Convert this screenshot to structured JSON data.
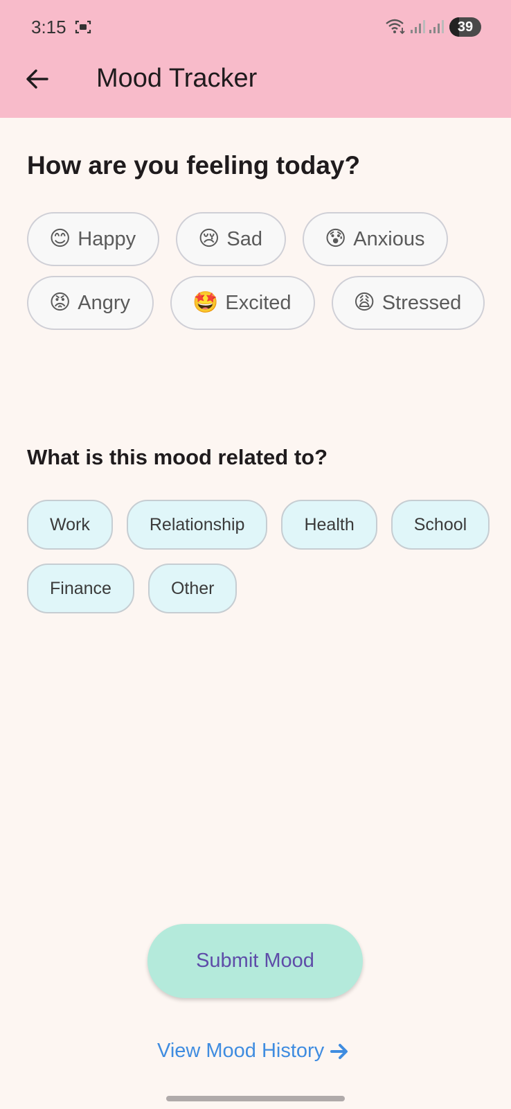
{
  "status_bar": {
    "time": "3:15",
    "battery": "39",
    "icons": [
      "screenshot-icon",
      "wifi-icon",
      "signal-icon",
      "signal-icon",
      "battery-icon"
    ]
  },
  "app_bar": {
    "title": "Mood Tracker",
    "back_icon": "back-arrow-icon",
    "background": "#f8bbca"
  },
  "mood_section": {
    "question": "How are you feeling today?",
    "moods": [
      {
        "emoji": "😊",
        "label": "Happy"
      },
      {
        "emoji": "😢",
        "label": "Sad"
      },
      {
        "emoji": "😰",
        "label": "Anxious"
      },
      {
        "emoji": "😡",
        "label": "Angry"
      },
      {
        "emoji": "🤩",
        "label": "Excited"
      },
      {
        "emoji": "😩",
        "label": "Stressed"
      }
    ]
  },
  "category_section": {
    "question": "What is this mood related to?",
    "categories": [
      "Work",
      "Relationship",
      "Health",
      "School",
      "Finance",
      "Other"
    ]
  },
  "actions": {
    "submit_label": "Submit Mood",
    "history_label": "View Mood History",
    "history_icon": "arrow-right-icon"
  },
  "colors": {
    "page_background": "#fdf6f2",
    "submit_button": "#b4eadb",
    "submit_text": "#5e4ca8",
    "link": "#3f8ce0",
    "category_chip": "#e0f6f9"
  }
}
